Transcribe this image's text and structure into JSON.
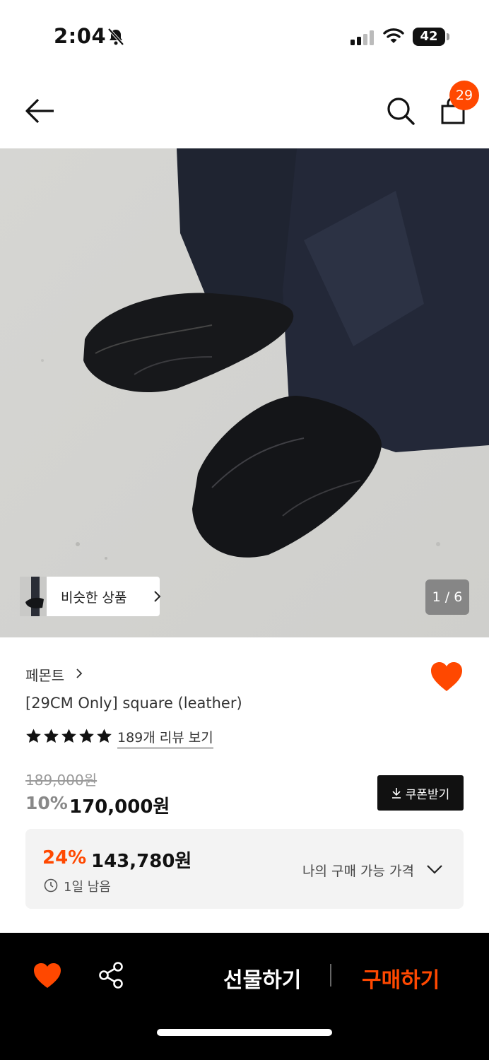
{
  "status_bar": {
    "time": "2:04",
    "battery": "42"
  },
  "nav": {
    "cart_count": "29"
  },
  "gallery": {
    "similar_label": "비슷한 상품",
    "counter": "1 / 6"
  },
  "product": {
    "brand": "페몬트",
    "title": "[29CM Only] square (leather)",
    "rating_stars": 5,
    "review_link": "189개 리뷰 보기",
    "original_price": "189,000원",
    "discount_rate": "10%",
    "sale_price": "170,000원",
    "coupon_button": "쿠폰받기"
  },
  "my_price": {
    "discount_rate": "24%",
    "price": "143,780원",
    "time_left": "1일 남음",
    "label": "나의 구매 가능 가격"
  },
  "bottom_bar": {
    "gift_label": "선물하기",
    "buy_label": "구매하기"
  },
  "colors": {
    "accent": "#ff4800",
    "dark": "#111111"
  }
}
